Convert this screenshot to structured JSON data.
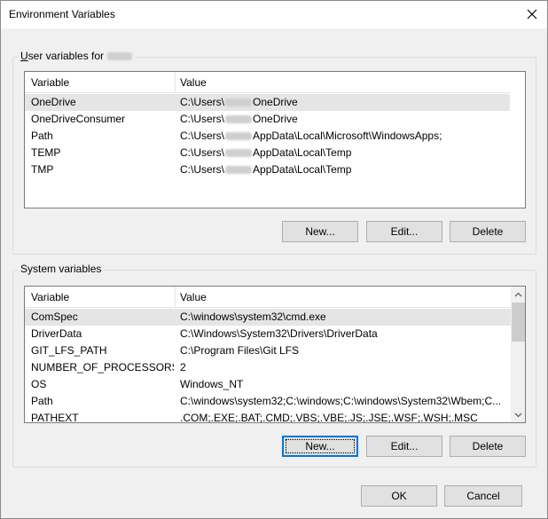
{
  "window": {
    "title": "Environment Variables"
  },
  "user_group": {
    "label_prefix": "User variables for ",
    "username_redacted": true
  },
  "user_table": {
    "headers": [
      "Variable",
      "Value"
    ],
    "rows": [
      {
        "variable": "OneDrive",
        "value_pre": "C:\\Users\\",
        "value_post": "OneDrive",
        "selected": true
      },
      {
        "variable": "OneDriveConsumer",
        "value_pre": "C:\\Users\\",
        "value_post": "OneDrive",
        "selected": false
      },
      {
        "variable": "Path",
        "value_pre": "C:\\Users\\",
        "value_post": "AppData\\Local\\Microsoft\\WindowsApps;",
        "selected": false
      },
      {
        "variable": "TEMP",
        "value_pre": "C:\\Users\\",
        "value_post": "AppData\\Local\\Temp",
        "selected": false
      },
      {
        "variable": "TMP",
        "value_pre": "C:\\Users\\",
        "value_post": "AppData\\Local\\Temp",
        "selected": false
      }
    ]
  },
  "user_buttons": {
    "new": "New...",
    "edit": "Edit...",
    "delete": "Delete"
  },
  "system_group": {
    "label": "System variables"
  },
  "system_table": {
    "headers": [
      "Variable",
      "Value"
    ],
    "rows": [
      {
        "variable": "ComSpec",
        "value": "C:\\windows\\system32\\cmd.exe",
        "selected": true
      },
      {
        "variable": "DriverData",
        "value": "C:\\Windows\\System32\\Drivers\\DriverData",
        "selected": false
      },
      {
        "variable": "GIT_LFS_PATH",
        "value": "C:\\Program Files\\Git LFS",
        "selected": false
      },
      {
        "variable": "NUMBER_OF_PROCESSORS",
        "value": "2",
        "selected": false
      },
      {
        "variable": "OS",
        "value": "Windows_NT",
        "selected": false
      },
      {
        "variable": "Path",
        "value": "C:\\windows\\system32;C:\\windows;C:\\windows\\System32\\Wbem;C...",
        "selected": false
      },
      {
        "variable": "PATHEXT",
        "value": ".COM;.EXE;.BAT;.CMD;.VBS;.VBE;.JS;.JSE;.WSF;.WSH;.MSC",
        "selected": false
      }
    ]
  },
  "system_buttons": {
    "new": "New...",
    "edit": "Edit...",
    "delete": "Delete"
  },
  "dialog_buttons": {
    "ok": "OK",
    "cancel": "Cancel"
  },
  "icons": {
    "close": "close-icon",
    "scroll_up": "chevron-up-icon",
    "scroll_down": "chevron-down-icon"
  },
  "colors": {
    "selection": "#e5e5e5",
    "default_button_border": "#0078d7",
    "button_bg": "#e1e1e1"
  }
}
